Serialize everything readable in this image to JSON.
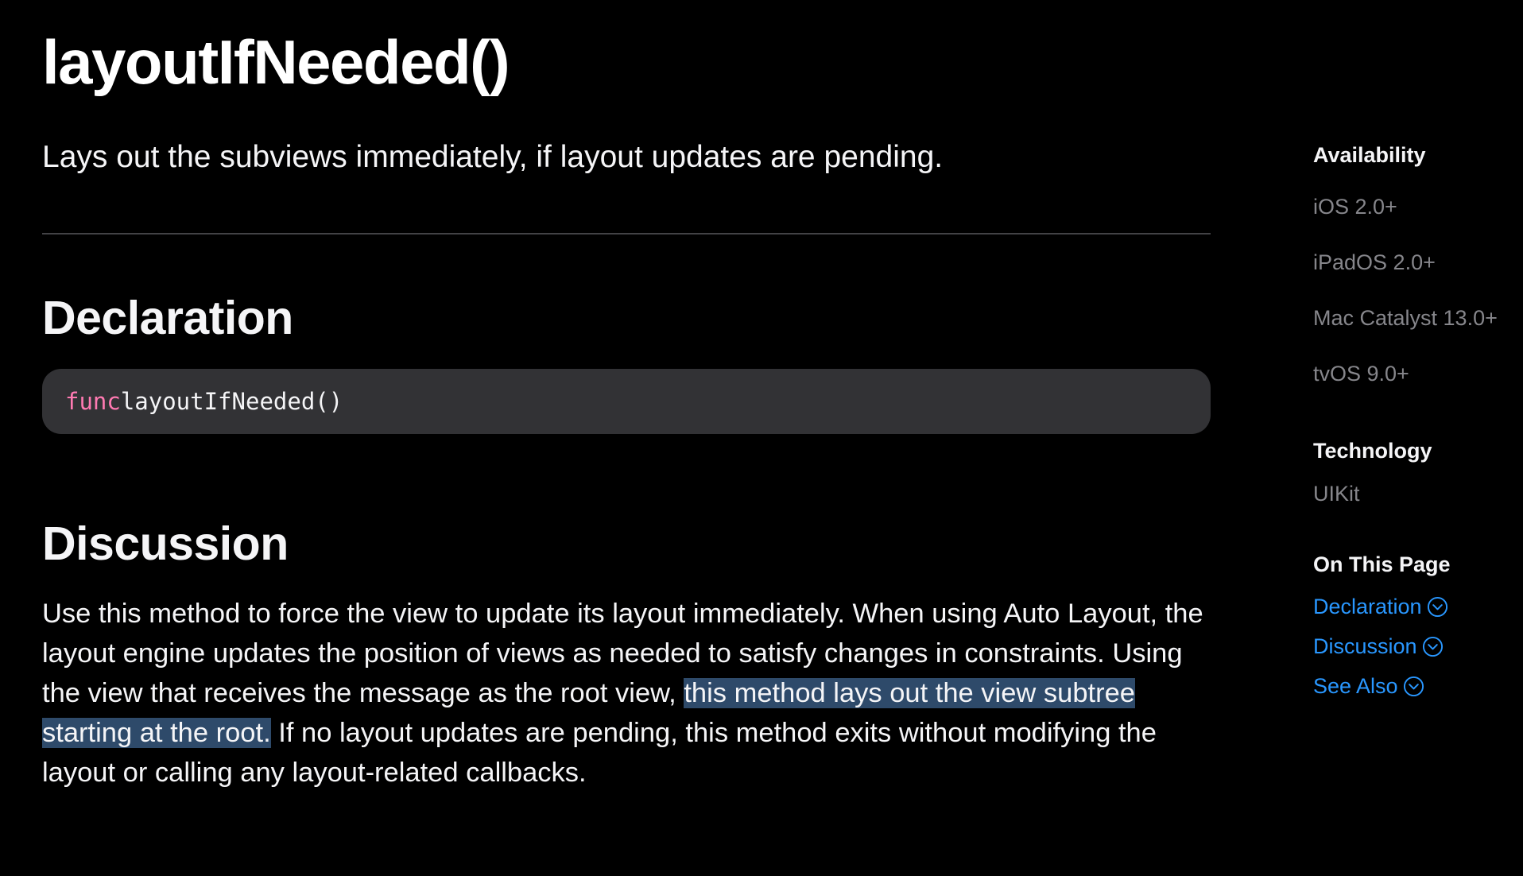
{
  "page": {
    "title": "layoutIfNeeded()",
    "abstract": "Lays out the subviews immediately, if layout updates are pending."
  },
  "declaration": {
    "heading": "Declaration",
    "keyword": "func",
    "signature": "layoutIfNeeded()"
  },
  "discussion": {
    "heading": "Discussion",
    "line1": "Use this method to force the view to update its layout immediately. When using Auto Layout, the",
    "line2": "layout engine updates the position of views as needed to satisfy changes in constraints. Using",
    "line3_plain": "the view that receives the message as the root view, ",
    "line3_highlight": "this method lays out the view subtree",
    "line4_highlight": "starting at the root.",
    "line4_plain": " If no layout updates are pending, this method exits without modifying the",
    "line5": "layout or calling any layout-related callbacks."
  },
  "sidebar": {
    "availability_heading": "Availability",
    "availability": [
      "iOS 2.0+",
      "iPadOS 2.0+",
      "Mac Catalyst 13.0+",
      "tvOS 9.0+"
    ],
    "technology_heading": "Technology",
    "technology": "UIKit",
    "on_this_page_heading": "On This Page",
    "links": [
      "Declaration",
      "Discussion",
      "See Also"
    ]
  },
  "colors": {
    "background": "#000000",
    "text": "#f5f5f7",
    "muted": "#86868b",
    "link": "#2997ff",
    "code_keyword": "#ff7ab2",
    "code_background": "#323235",
    "selection_highlight": "#2e4a6a"
  },
  "icons": {
    "link_chevron": "chevron-down-circle-icon"
  }
}
